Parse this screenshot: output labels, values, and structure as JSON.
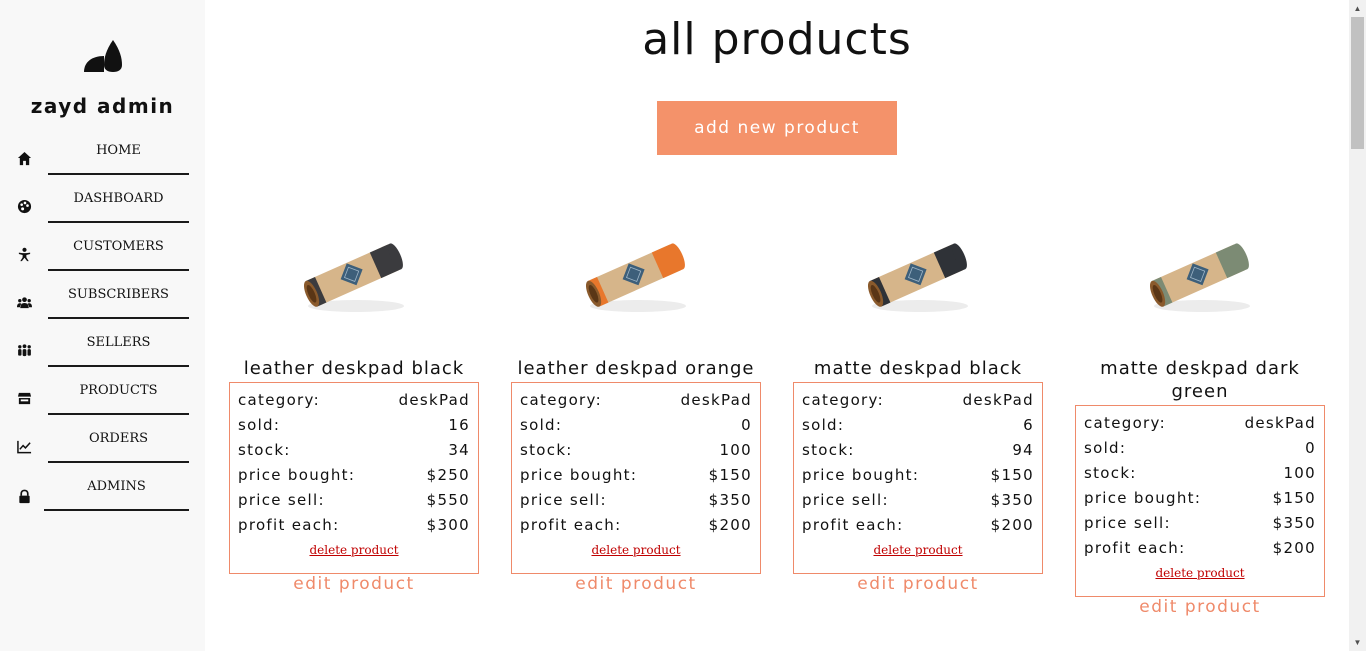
{
  "sidebar": {
    "brand": "zayd admin",
    "items": [
      {
        "label": "HOME",
        "icon": "home-icon"
      },
      {
        "label": "DASHBOARD",
        "icon": "palette-icon"
      },
      {
        "label": "CUSTOMERS",
        "icon": "person-icon"
      },
      {
        "label": "SUBSCRIBERS",
        "icon": "users-icon"
      },
      {
        "label": "SELLERS",
        "icon": "group-icon"
      },
      {
        "label": "PRODUCTS",
        "icon": "store-icon"
      },
      {
        "label": "ORDERS",
        "icon": "chart-line-icon"
      },
      {
        "label": "ADMINS",
        "icon": "lock-icon"
      }
    ]
  },
  "main": {
    "title": "all products",
    "add_button": "add new product",
    "labels": {
      "category": "category:",
      "sold": "sold:",
      "stock": "stock:",
      "price_bought": "price bought:",
      "price_sell": "price sell:",
      "profit_each": "profit each:",
      "delete": "delete product",
      "edit": "edit product"
    },
    "products": [
      {
        "name": "leather deskpad black",
        "category": "deskPad",
        "sold": "16",
        "stock": "34",
        "price_bought": "$250",
        "price_sell": "$550",
        "profit_each": "$300",
        "band_color": "#3b3b3e"
      },
      {
        "name": "leather deskpad orange",
        "category": "deskPad",
        "sold": "0",
        "stock": "100",
        "price_bought": "$150",
        "price_sell": "$350",
        "profit_each": "$200",
        "band_color": "#e8772c"
      },
      {
        "name": "matte deskpad black",
        "category": "deskPad",
        "sold": "6",
        "stock": "94",
        "price_bought": "$150",
        "price_sell": "$350",
        "profit_each": "$200",
        "band_color": "#2f3237"
      },
      {
        "name": "matte deskpad dark green",
        "category": "deskPad",
        "sold": "0",
        "stock": "100",
        "price_bought": "$150",
        "price_sell": "$350",
        "profit_each": "$200",
        "band_color": "#7c8b74"
      }
    ]
  },
  "colors": {
    "accent": "#f4926a",
    "border": "#ef8a6a",
    "delete": "#c00000",
    "sidebar_bg": "#f8f8f8"
  }
}
